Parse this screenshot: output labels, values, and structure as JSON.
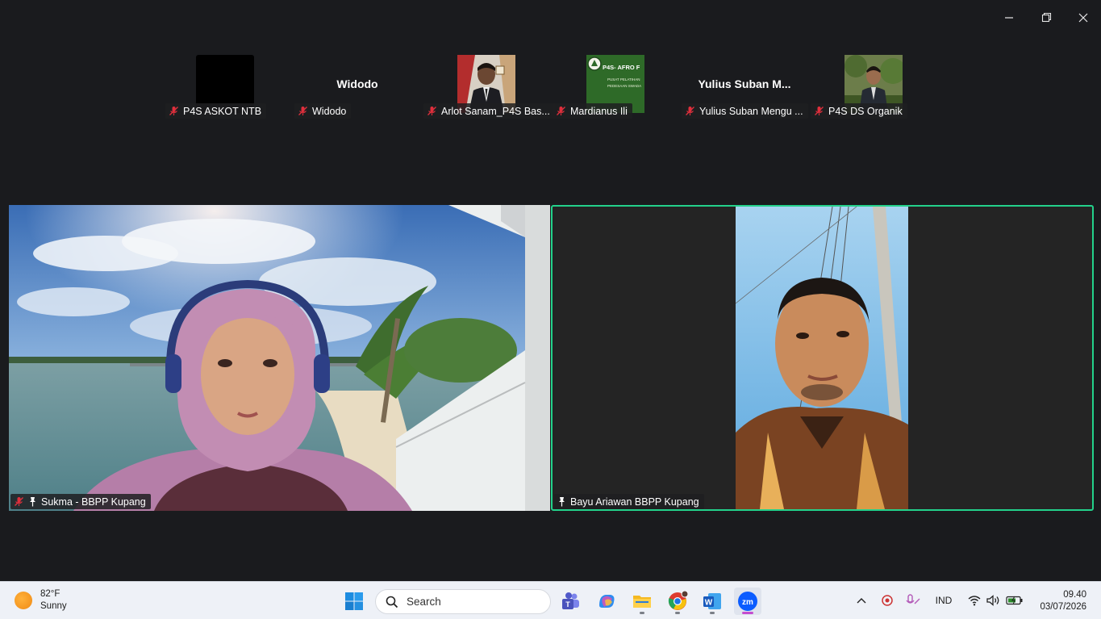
{
  "window": {
    "controls": [
      "minimize",
      "restore",
      "close"
    ]
  },
  "gallery_strip": [
    {
      "name_label": "P4S ASKOT NTB",
      "display": "thumb-black",
      "muted": true
    },
    {
      "name_label": "Widodo",
      "display_name": "Widodo",
      "display": "name",
      "muted": true
    },
    {
      "name_label": "Arlot Sanam_P4S Bas...",
      "display": "thumb-photo",
      "muted": true
    },
    {
      "name_label": "Mardianus Ili",
      "display": "thumb-logo",
      "logo_text": "P4S- AFRO F",
      "logo_sub1": "PUSAT PELATIHAN",
      "logo_sub2": "PEDESAAN SWADA",
      "muted": true
    },
    {
      "name_label": "Yulius Suban Mengu ...",
      "display_name": "Yulius Suban M...",
      "display": "name",
      "muted": true
    },
    {
      "name_label": "P4S DS Organik",
      "display": "thumb-photo2",
      "muted": true
    }
  ],
  "main_videos": [
    {
      "name_label": "Sukma - BBPP Kupang",
      "muted": true,
      "pinned": true,
      "active_speaker": false
    },
    {
      "name_label": "Bayu Ariawan BBPP Kupang",
      "muted": false,
      "pinned": true,
      "active_speaker": true
    }
  ],
  "taskbar": {
    "weather_temp": "82°F",
    "weather_desc": "Sunny",
    "search_placeholder": "Search",
    "apps": [
      "windows-start",
      "search",
      "teams",
      "copilot",
      "file-explorer",
      "chrome",
      "word",
      "zoom"
    ],
    "tray_lang": "IND",
    "time": "09.40",
    "date": "03/07/2026"
  },
  "colors": {
    "background": "#1a1b1e",
    "active_speaker_border": "#23d18b",
    "mute_red": "#e02f3c",
    "taskbar": "#eef1f7"
  }
}
